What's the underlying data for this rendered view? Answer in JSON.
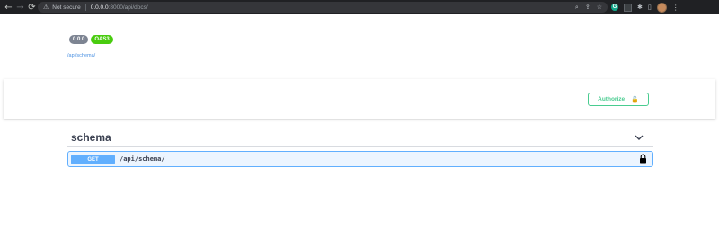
{
  "browser": {
    "nav": {
      "back_glyph": "←",
      "forward_glyph": "→",
      "reload_glyph": "⟳"
    },
    "address": {
      "security_glyph": "⚠",
      "security_label": "Not secure",
      "host": "0.0.0.0",
      "rest": ":8000/api/docs/"
    },
    "omnibox_icons": [
      "zoom-icon",
      "share-icon",
      "bookmark-star-icon"
    ],
    "omnibox_glyphs": {
      "zoom": "⌕",
      "share": "⇪",
      "star": "☆"
    },
    "extensions": {
      "grammarly_letter": "G",
      "puzzle_glyph": "✱",
      "sidebar_glyph": "▯",
      "menu_glyph": "⋮"
    }
  },
  "info": {
    "version_badge": "0.0.0",
    "spec_badge": "OAS3",
    "schema_link": "/api/schema/"
  },
  "auth": {
    "authorize_label": "Authorize",
    "lock_glyph": "🔓"
  },
  "tag": {
    "name": "schema",
    "operations": [
      {
        "method": "GET",
        "path": "/api/schema/"
      }
    ]
  },
  "colors": {
    "get": "#61affe",
    "authorize": "#49cc90",
    "oas_badge": "#49cc0f",
    "version_badge": "#7d8492",
    "chrome": "#202124"
  }
}
